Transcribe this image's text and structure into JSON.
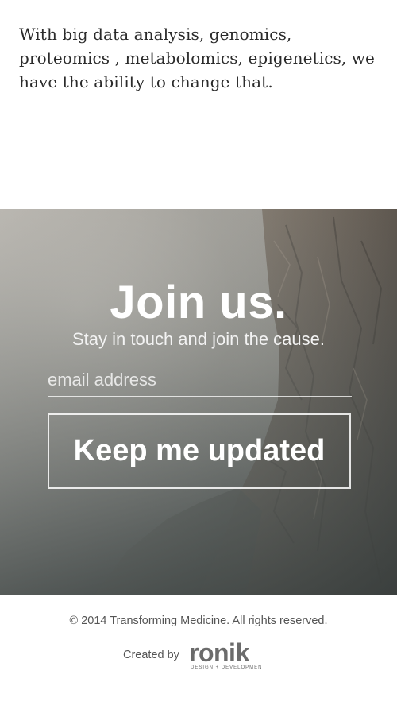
{
  "intro": {
    "text": "With big data analysis, genomics, proteomics , metabolomics, epigenetics, we have the ability to change that."
  },
  "signup": {
    "title": "Join us.",
    "subtitle": "Stay in touch and join the cause.",
    "email_placeholder": "email address",
    "email_value": "",
    "button_label": "Keep me updated"
  },
  "footer": {
    "copyright": "© 2014 Transforming Medicine. All rights reserved.",
    "created_by": "Created by",
    "logo_text": "ronik",
    "logo_tagline": "DESIGN + DEVELOPMENT"
  },
  "colors": {
    "text_dark": "#2b2b2b",
    "footer_text": "#555555",
    "logo_gray": "#6b6b6b",
    "white": "#ffffff"
  }
}
